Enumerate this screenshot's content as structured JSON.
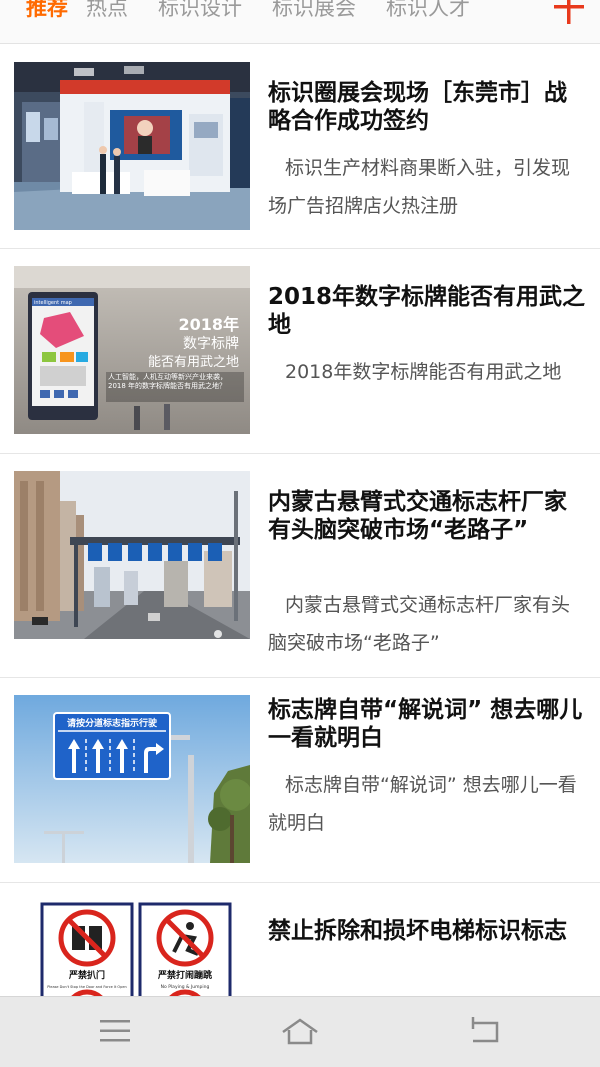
{
  "tabs": [
    {
      "label": "推荐",
      "active": true
    },
    {
      "label": "热点",
      "active": false
    },
    {
      "label": "标识设计",
      "active": false
    },
    {
      "label": "标识展会",
      "active": false
    },
    {
      "label": "标识人才",
      "active": false
    }
  ],
  "add_icon": "plus-icon",
  "accent_color": "#ff6a00",
  "articles": [
    {
      "title": "标识圈展会现场［东莞市］战略合作成功签约",
      "summary": "标识生产材料商果断入驻，引发现场广告招牌店火热注册"
    },
    {
      "title": "2018年数字标牌能否有用武之地",
      "summary": "2018年数字标牌能否有用武之地",
      "image_text": {
        "heading_year": "2018年",
        "heading_line2": "数字标牌",
        "heading_line3": "能否有用武之地",
        "kiosk_header": "intelligent map",
        "caption": "人工智能，人机互动等新兴产业来袭，2018 年的数字标牌能否有用武之地？"
      }
    },
    {
      "title": "内蒙古悬臂式交通标志杆厂家有头脑突破市场“老路子”",
      "summary": "内蒙古悬臂式交通标志杆厂家有头脑突破市场“老路子”"
    },
    {
      "title": "标志牌自带“解说词” 想去哪儿一看就明白",
      "summary": "标志牌自带“解说词” 想去哪儿一看就明白",
      "image_text": {
        "sign_text": "请按分道标志指示行驶"
      }
    },
    {
      "title": "禁止拆除和损坏电梯标识标志",
      "summary": "",
      "image_text": {
        "sign1_cn": "严禁扒门",
        "sign1_en": "Please Don't Stop the Door and Force It Open",
        "sign2_cn": "严禁打闹蹦跳",
        "sign2_en": "No Playing & Jumping"
      }
    }
  ],
  "system_nav": [
    "menu-icon",
    "home-icon",
    "back-icon"
  ]
}
